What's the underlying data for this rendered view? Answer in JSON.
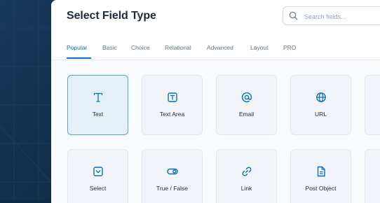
{
  "modal": {
    "title": "Select Field Type",
    "search_placeholder": "Search fields..."
  },
  "tabs": [
    {
      "label": "Popular",
      "active": true
    },
    {
      "label": "Basic"
    },
    {
      "label": "Choice"
    },
    {
      "label": "Relational"
    },
    {
      "label": "Advanced"
    },
    {
      "label": "Layout"
    },
    {
      "label": "PRO"
    }
  ],
  "fields": [
    {
      "label": "Text",
      "icon": "text-t-icon",
      "selected": true
    },
    {
      "label": "Text Area",
      "icon": "text-area-icon"
    },
    {
      "label": "Email",
      "icon": "at-sign-icon"
    },
    {
      "label": "URL",
      "icon": "globe-icon"
    },
    {
      "label": "Select",
      "icon": "select-dropdown-icon"
    },
    {
      "label": "True / False",
      "icon": "toggle-icon"
    },
    {
      "label": "Link",
      "icon": "link-icon"
    },
    {
      "label": "Post Object",
      "icon": "document-icon"
    }
  ],
  "colors": {
    "accent": "#0770c6",
    "selected_bg": "#e6f0f9",
    "selected_border": "#5a9fd6",
    "backdrop": "#0e2944"
  }
}
